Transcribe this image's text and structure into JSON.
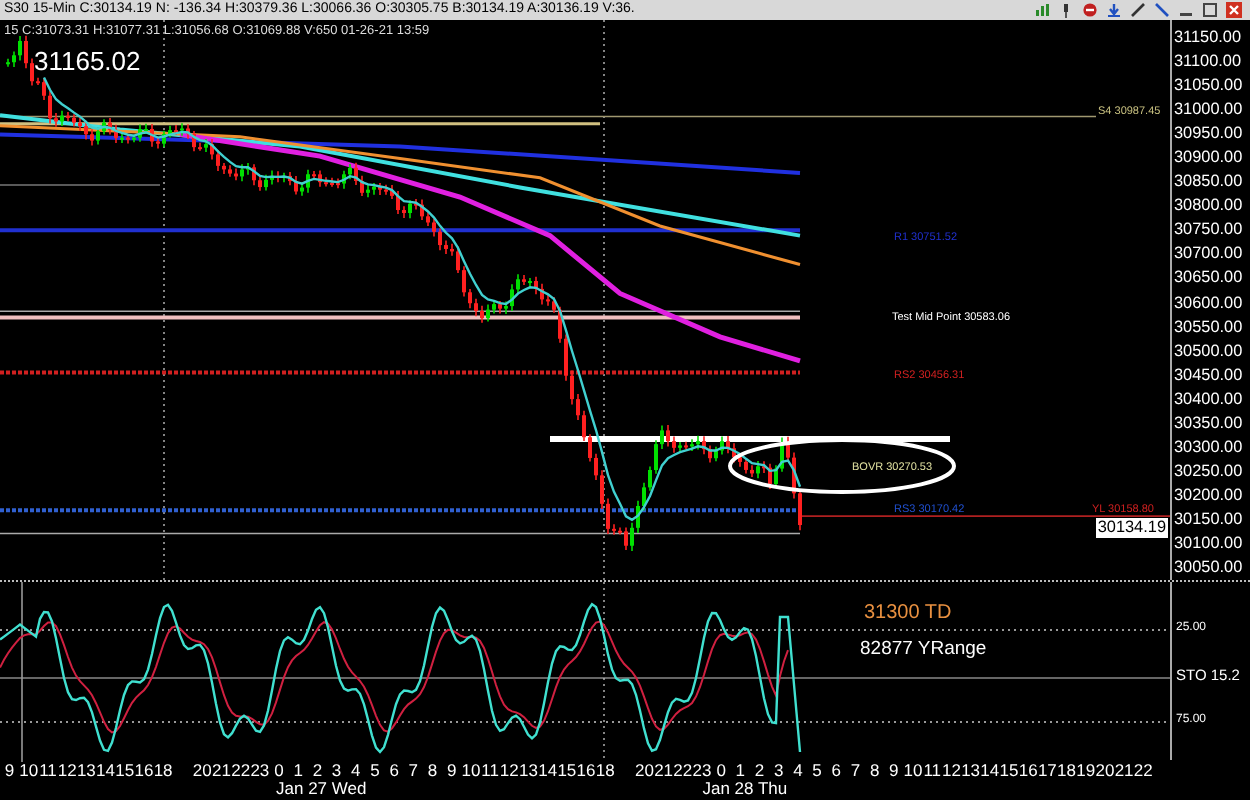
{
  "header": {
    "title": "S30 15-Min C:30134.19 N: -136.34 H:30379.36 L:30066.36 O:30305.75 B:30134.19 A:30136.19 V:36."
  },
  "bar_info": "15 C:31073.31 H:31077.31 L:31056.68 O:31069.88 V:650 01-26-21 13:59",
  "high_label": "31165.02",
  "price_axis": {
    "ticks": [
      "31150.00",
      "31100.00",
      "31050.00",
      "31000.00",
      "30950.00",
      "30900.00",
      "30850.00",
      "30800.00",
      "30750.00",
      "30700.00",
      "30650.00",
      "30600.00",
      "30550.00",
      "30500.00",
      "30450.00",
      "30400.00",
      "30350.00",
      "30300.00",
      "30250.00",
      "30200.00",
      "30150.00",
      "30100.00",
      "30050.00"
    ],
    "last_price": "30134.19"
  },
  "levels": [
    {
      "label": "S4 30987.45",
      "color": "#c8c080"
    },
    {
      "label": "R1 30751.52",
      "color": "#2030d0"
    },
    {
      "label": "Test Mid Point 30583.06",
      "color": "#ffffff"
    },
    {
      "label": "RS2 30456.31",
      "color": "#d02020"
    },
    {
      "label": "BOVR 30270.53",
      "color": "#e0e0a0"
    },
    {
      "label": "RS3 30170.42",
      "color": "#2050d0"
    },
    {
      "label": "YL 30158.80",
      "color": "#d02020"
    }
  ],
  "oscillator": {
    "labels": [
      {
        "text": "31300 TD",
        "color": "#e89040"
      },
      {
        "text": "82877 YRange",
        "color": "#ffffff"
      }
    ],
    "axis": [
      "25.00",
      "STO 15.2",
      "75.00"
    ]
  },
  "time_axis": {
    "groups": [
      [
        "9",
        "10",
        "11",
        "12",
        "13",
        "14",
        "15",
        "16",
        "18"
      ],
      [
        "20",
        "21",
        "22",
        "23",
        "0",
        "1",
        "2",
        "3",
        "4",
        "5",
        "6",
        "7",
        "8",
        "9",
        "10",
        "11",
        "12",
        "13",
        "14",
        "15",
        "16",
        "18"
      ],
      [
        "20",
        "21",
        "22",
        "23",
        "0",
        "1",
        "2",
        "3",
        "4",
        "5",
        "6",
        "7",
        "8",
        "9",
        "10",
        "11",
        "12",
        "13",
        "14",
        "15",
        "16",
        "17",
        "18",
        "19",
        "20",
        "21",
        "22"
      ]
    ],
    "days": [
      "Jan 27 Wed",
      "Jan 28 Thu"
    ]
  }
}
